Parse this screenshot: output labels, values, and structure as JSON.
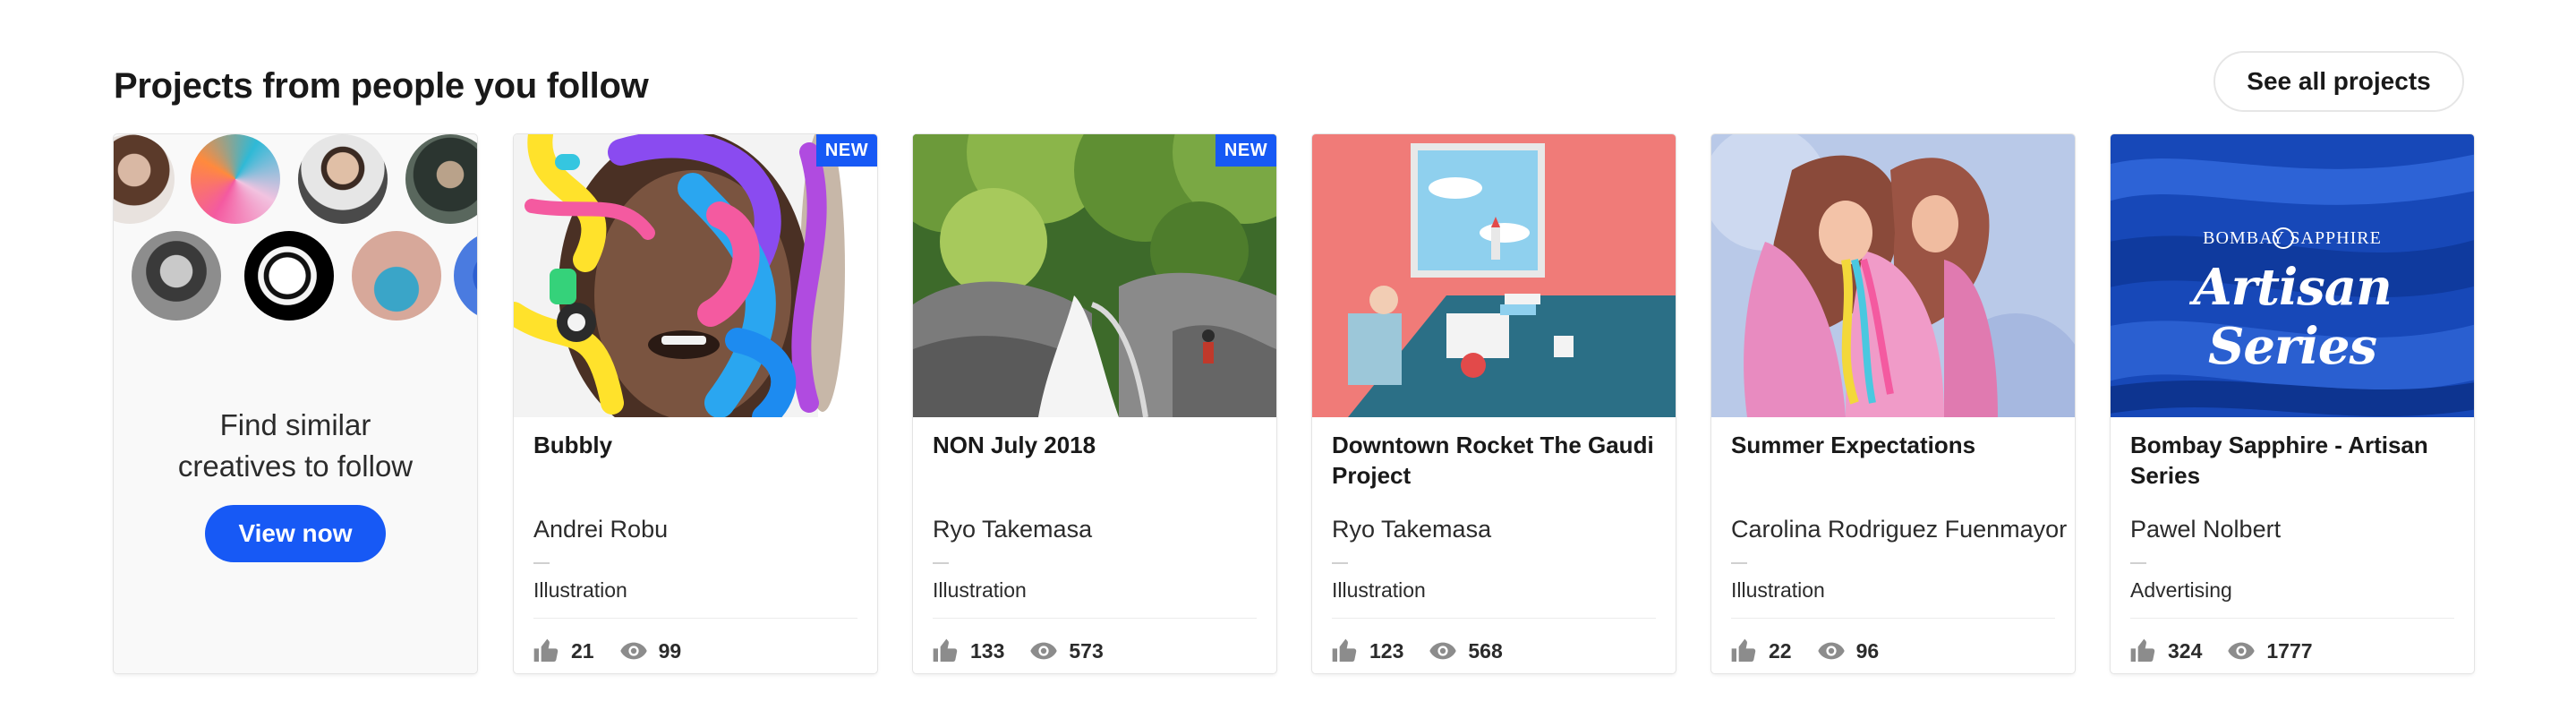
{
  "section": {
    "title": "Projects from people you follow",
    "see_all_label": "See all projects"
  },
  "promo": {
    "text_line1": "Find similar",
    "text_line2": "creatives to follow",
    "button_label": "View now"
  },
  "projects": [
    {
      "title": "Bubbly",
      "owner": "Andrei Robu",
      "field": "Illustration",
      "likes": "21",
      "views": "99",
      "badge": "NEW"
    },
    {
      "title": "NON July 2018",
      "owner": "Ryo Takemasa",
      "field": "Illustration",
      "likes": "133",
      "views": "573",
      "badge": "NEW"
    },
    {
      "title": "Downtown Rocket The Gaudi Project",
      "owner": "Ryo Takemasa",
      "field": "Illustration",
      "likes": "123",
      "views": "568"
    },
    {
      "title": "Summer Expectations",
      "owner": "Carolina Rodriguez Fuenmayor",
      "field": "Illustration",
      "likes": "22",
      "views": "96"
    },
    {
      "title": "Bombay Sapphire - Artisan Series",
      "owner": "Pawel Nolbert",
      "field": "Advertising",
      "likes": "324",
      "views": "1777",
      "cover_brand": "BOMBAY SAPPHIRE",
      "cover_script": "Artisan Series"
    }
  ],
  "icons": {
    "likes": "thumbs-up-icon",
    "views": "eye-icon"
  },
  "colors": {
    "accent": "#1759f5",
    "icon_gray": "#8c8c8c"
  }
}
